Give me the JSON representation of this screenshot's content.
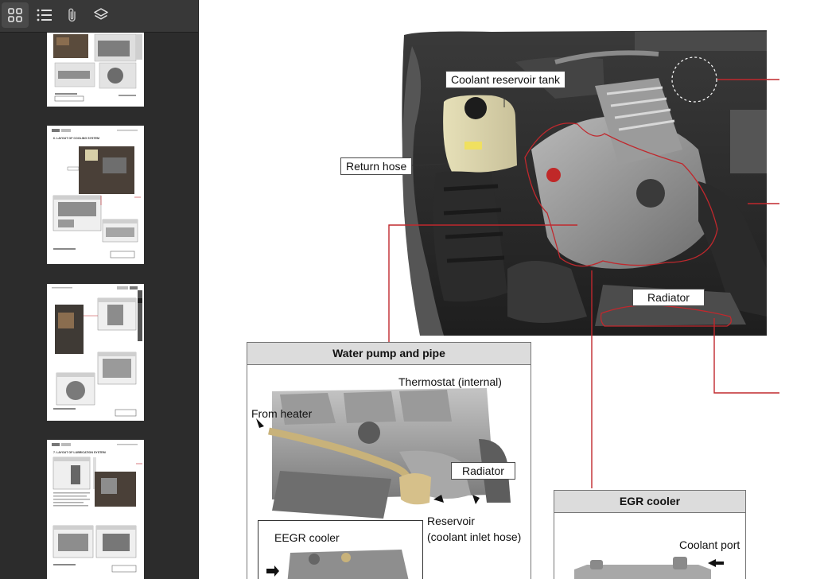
{
  "sidebar": {
    "tools": [
      {
        "name": "thumbnails-view",
        "icon": "grid-icon",
        "active": true
      },
      {
        "name": "outline-view",
        "icon": "list-icon",
        "active": false
      },
      {
        "name": "attachments-view",
        "icon": "paperclip-icon",
        "active": false
      },
      {
        "name": "layers-view",
        "icon": "layers-icon",
        "active": false
      }
    ],
    "thumbnails": [
      {
        "page": "thumbnail-page-1",
        "selected": false
      },
      {
        "page": "thumbnail-page-2",
        "selected": true,
        "heading": "6. LAYOUT OF COOLING SYSTEM"
      },
      {
        "page": "thumbnail-page-3",
        "selected": false
      },
      {
        "page": "thumbnail-page-4",
        "selected": false,
        "heading": "7. LAYOUT OF LUBRICATION SYSTEM"
      }
    ]
  },
  "document": {
    "engine_labels": {
      "coolant_reservoir_tank": "Coolant reservoir tank",
      "return_hose": "Return hose",
      "radiator": "Radiator"
    },
    "water_pump_box": {
      "title": "Water pump and pipe",
      "thermostat": "Thermostat (internal)",
      "from_heater": "From heater",
      "radiator": "Radiator",
      "reservoir_line1": "Reservoir",
      "reservoir_line2": "(coolant inlet hose)",
      "eegr_cooler": "EEGR cooler"
    },
    "egr_box": {
      "title": "EGR cooler",
      "coolant_port": "Coolant port"
    }
  },
  "colors": {
    "sidebar_bg": "#2c2c2c",
    "toolbar_bg": "#383838",
    "callout_line": "#c0282d",
    "box_header": "#dcdcdc"
  }
}
